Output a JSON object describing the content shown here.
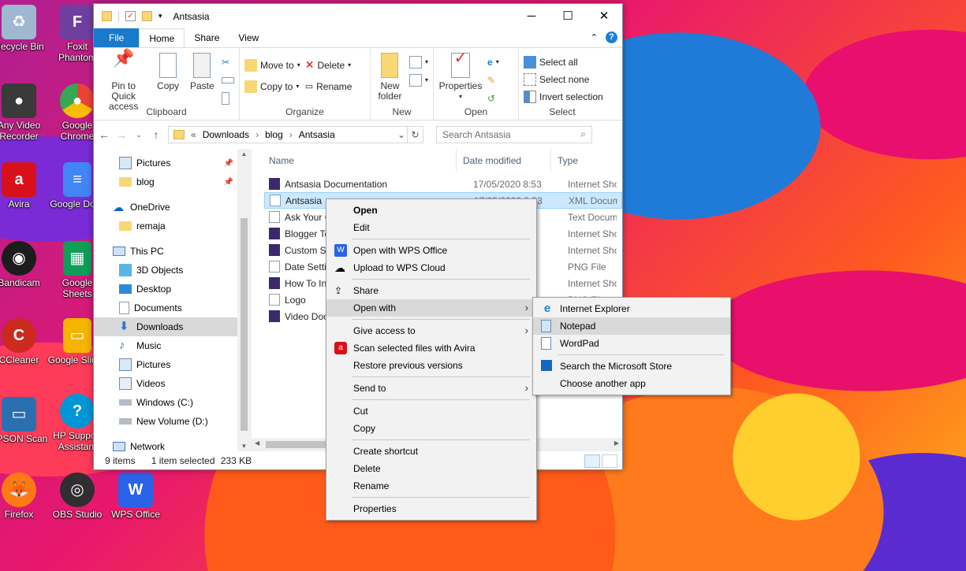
{
  "desktop": {
    "icons": [
      {
        "label": "Recycle Bin",
        "color": "#9fb7cf"
      },
      {
        "label": "Any Video Recorder",
        "color": "#3a3a3a"
      },
      {
        "label": "Avira",
        "color": "#d8101a"
      },
      {
        "label": "Bandicam",
        "color": "#1c1c1c"
      },
      {
        "label": "CCleaner",
        "color": "#cc2a1e"
      },
      {
        "label": "EPSON Scan",
        "color": "#2a6fb0"
      },
      {
        "label": "Firefox",
        "color": "#ff7a14"
      },
      {
        "label": "Foxit Phantom",
        "color": "#6f3fa0"
      },
      {
        "label": "Google Chrome",
        "color": "#34a853"
      },
      {
        "label": "Google Docs",
        "color": "#4285f4"
      },
      {
        "label": "Google Sheets",
        "color": "#0f9d58"
      },
      {
        "label": "Google Slides",
        "color": "#f4b400"
      },
      {
        "label": "HP Support Assistant",
        "color": "#0096d6"
      },
      {
        "label": "OBS Studio",
        "color": "#302e31"
      },
      {
        "label": "WPS Office",
        "color": "#2a62e8"
      }
    ]
  },
  "window": {
    "title": "Antsasia",
    "tabs": {
      "file": "File",
      "home": "Home",
      "share": "Share",
      "view": "View"
    },
    "ribbon": {
      "clipboard": {
        "pin": "Pin to Quick access",
        "copy": "Copy",
        "paste": "Paste",
        "label": "Clipboard"
      },
      "organize": {
        "move_to": "Move to",
        "copy_to": "Copy to",
        "delete": "Delete",
        "rename": "Rename",
        "label": "Organize"
      },
      "new": {
        "new_folder": "New folder",
        "label": "New"
      },
      "open": {
        "properties": "Properties",
        "label": "Open"
      },
      "select": {
        "select_all": "Select all",
        "select_none": "Select none",
        "invert": "Invert selection",
        "label": "Select"
      }
    },
    "address": {
      "prefix": "«",
      "crumbs": [
        "Downloads",
        "blog",
        "Antsasia"
      ]
    },
    "search_placeholder": "Search Antsasia",
    "nav": [
      {
        "label": "Pictures",
        "pinned": true
      },
      {
        "label": "blog",
        "pinned": true
      },
      {
        "label": "OneDrive"
      },
      {
        "label": "remaja"
      },
      {
        "label": "This PC"
      },
      {
        "label": "3D Objects"
      },
      {
        "label": "Desktop"
      },
      {
        "label": "Documents"
      },
      {
        "label": "Downloads"
      },
      {
        "label": "Music"
      },
      {
        "label": "Pictures"
      },
      {
        "label": "Videos"
      },
      {
        "label": "Windows (C:)"
      },
      {
        "label": "New Volume (D:)"
      },
      {
        "label": "Network"
      }
    ],
    "columns": {
      "name": "Name",
      "date": "Date modified",
      "type": "Type"
    },
    "files": [
      {
        "name": "Antsasia Documentation",
        "date": "17/05/2020 8:53",
        "type": "Internet Shor"
      },
      {
        "name": "Antsasia",
        "date": "17/05/2020 8:53",
        "type": "XML Docume"
      },
      {
        "name": "Ask Your C",
        "date": "",
        "type": "Text Docume"
      },
      {
        "name": "Blogger Te",
        "date": "",
        "type": "Internet Shor"
      },
      {
        "name": "Custom S",
        "date": "",
        "type": "Internet Shor"
      },
      {
        "name": "Date Setti",
        "date": "",
        "type": "PNG File"
      },
      {
        "name": "How To In",
        "date": "",
        "type": "Internet Shor"
      },
      {
        "name": "Logo",
        "date": "",
        "type": "PNG File"
      },
      {
        "name": "Video Doc",
        "date": "",
        "type": ""
      }
    ],
    "status": {
      "count": "9 items",
      "selected": "1 item selected",
      "size": "233 KB"
    }
  },
  "context_menu": {
    "open": "Open",
    "edit": "Edit",
    "open_wps": "Open with WPS Office",
    "upload_wps": "Upload to WPS Cloud",
    "share": "Share",
    "open_with": "Open with",
    "give_access": "Give access to",
    "scan_avira": "Scan selected files with Avira",
    "restore": "Restore previous versions",
    "send_to": "Send to",
    "cut": "Cut",
    "copy": "Copy",
    "create_shortcut": "Create shortcut",
    "delete": "Delete",
    "rename": "Rename",
    "properties": "Properties"
  },
  "open_with_menu": {
    "ie": "Internet Explorer",
    "notepad": "Notepad",
    "wordpad": "WordPad",
    "store": "Search the Microsoft Store",
    "choose": "Choose another app"
  }
}
